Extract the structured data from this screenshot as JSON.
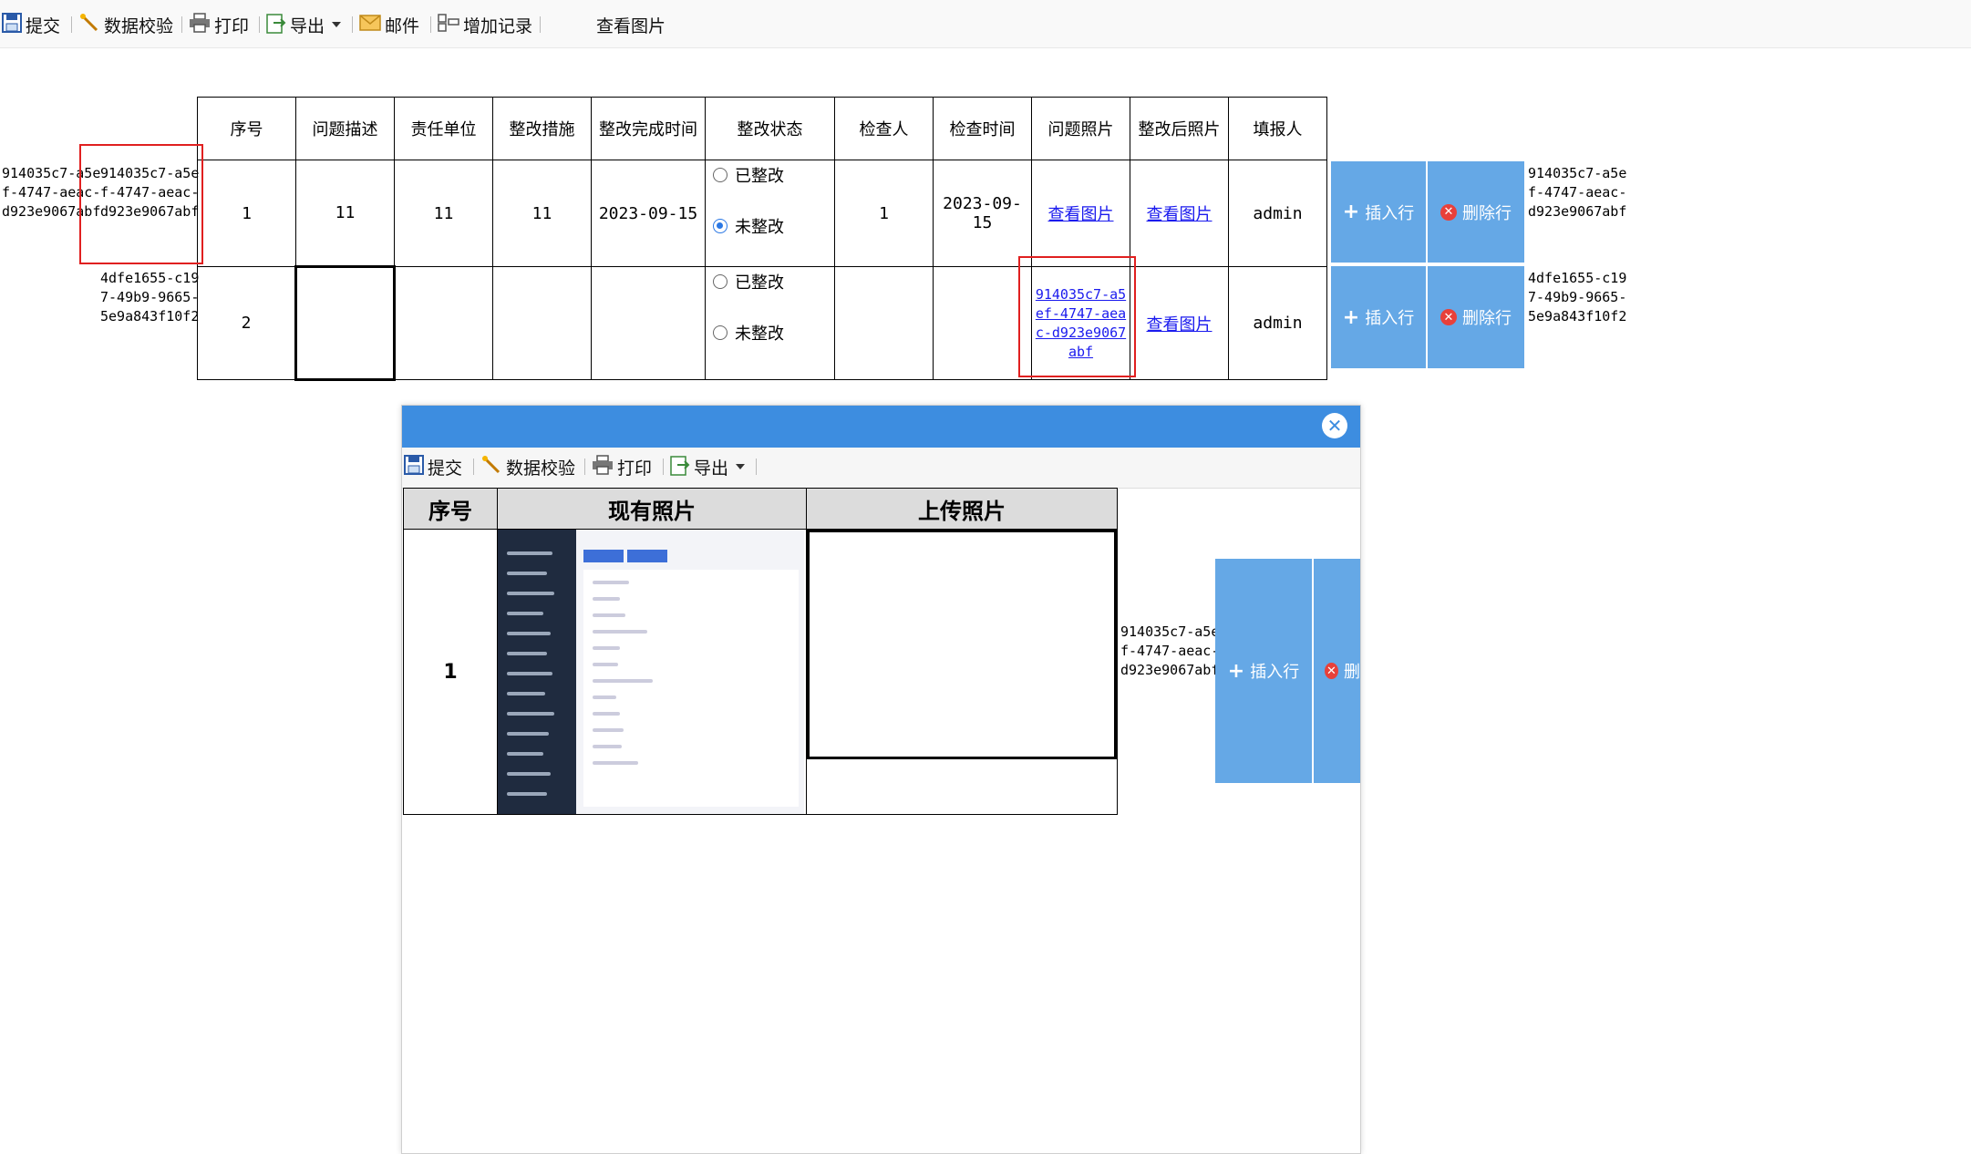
{
  "toolbar": {
    "items": [
      {
        "label": "提交",
        "icon": "save-icon"
      },
      {
        "label": "数据校验",
        "icon": "wand-icon"
      },
      {
        "label": "打印",
        "icon": "printer-icon"
      },
      {
        "label": "导出",
        "icon": "export-icon"
      },
      {
        "label": "邮件",
        "icon": "mail-icon"
      },
      {
        "label": "增加记录",
        "icon": "add-record-icon"
      }
    ],
    "view_image_label": "查看图片"
  },
  "table": {
    "headers": [
      "序号",
      "问题描述",
      "责任单位",
      "整改措施",
      "整改完成时间",
      "整改状态",
      "检查人",
      "检查时间",
      "问题照片",
      "整改后照片",
      "填报人"
    ],
    "rows": [
      {
        "left_id": "914035c7-a5ef-4747-aeac-d923e9067abf",
        "inner_id": "914035c7-a5ef-4747-aeac-d923e9067abf",
        "seq": "1",
        "description": "11",
        "unit": "11",
        "measure": "11",
        "finish_time": "2023-09-15",
        "status_options": [
          "已整改",
          "未整改"
        ],
        "status_selected": "未整改",
        "inspector": "1",
        "inspect_time": "2023-09-15",
        "problem_photo": "查看图片",
        "after_photo": "查看图片",
        "reporter": "admin",
        "right_id": "914035c7-a5ef-4747-aeac-d923e9067abf"
      },
      {
        "inner_id": "4dfe1655-c197-49b9-9665-5e9a843f10f2",
        "seq": "2",
        "description": "",
        "unit": "",
        "measure": "",
        "finish_time": "",
        "status_options": [
          "已整改",
          "未整改"
        ],
        "status_selected": "",
        "inspector": "",
        "inspect_time": "",
        "problem_photo": "914035c7-a5ef-4747-aeac-d923e9067abf",
        "after_photo": "查看图片",
        "reporter": "admin",
        "right_id": "4dfe1655-c197-49b9-9665-5e9a843f10f2"
      }
    ],
    "insert_row_label": "插入行",
    "delete_row_label": "删除行"
  },
  "dialog": {
    "toolbar": {
      "items": [
        {
          "label": "提交",
          "icon": "save-icon"
        },
        {
          "label": "数据校验",
          "icon": "wand-icon"
        },
        {
          "label": "打印",
          "icon": "printer-icon"
        },
        {
          "label": "导出",
          "icon": "export-icon"
        }
      ]
    },
    "table": {
      "headers": [
        "序号",
        "现有照片",
        "上传照片"
      ],
      "rows": [
        {
          "seq": "1",
          "photo_alt": "screenshot"
        }
      ]
    },
    "side_id": "914035c7-a5ef-4747-aeac-d923e9067abf",
    "insert_row_label": "插入行",
    "delete_row_label_partial": "删"
  },
  "colors": {
    "accent_blue": "#3d8de0",
    "button_blue": "#65a8e6",
    "link": "#1a1aee",
    "highlight_red": "#e02020",
    "delete_red": "#e8403a"
  }
}
